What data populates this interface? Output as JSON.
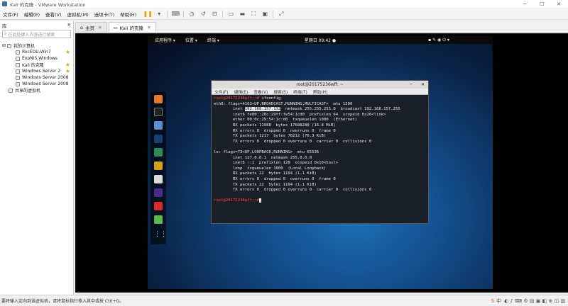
{
  "window": {
    "title": "Kali 的克隆 - VMware Workstation"
  },
  "menu": [
    "文件(F)",
    "编辑(E)",
    "查看(V)",
    "虚拟机(M)",
    "选项卡(T)",
    "帮助(H)"
  ],
  "library": {
    "title": "库",
    "search_placeholder": "在此处键入内容进行搜索",
    "root": "我的计算机",
    "vms": [
      "RocEDU,Win7",
      "ExpNIS.Windows",
      "Kali 的克隆",
      "Windows Server 2",
      "Windows Server 2008",
      "Windows Server 2008"
    ],
    "shared": "共享的虚拟机"
  },
  "tabs": [
    {
      "label": "主页"
    },
    {
      "label": "Kali 的克隆"
    }
  ],
  "guest": {
    "apps": "应用程序 ▾",
    "places": "位置 ▾",
    "terminal": "终端 ▾",
    "clock": "星期日 09:42 ●"
  },
  "terminal": {
    "title": "root@20175236wff: ~",
    "menu": [
      "文件(F)",
      "编辑(E)",
      "查看(V)",
      "搜索(S)",
      "终端(T)",
      "帮助(H)"
    ],
    "prompt": "root@20175236wff:~#",
    "cmd": " ifconfig",
    "lines": [
      "eth0: flags=4163<UP,BROADCAST,RUNNING,MULTICAST>  mtu 1500",
      "        inet ",
      "192.168.157.132",
      "  netmask 255.255.255.0  broadcast 192.168.157.255",
      "        inet6 fe80::20c:29ff:fe54:1cd0  prefixlen 64  scopeid 0x20<link>",
      "        ether 00:0c:29:54:1c:d0  txqueuelen 1000  (Ethernet)",
      "        RX packets 11988  bytes 17688288 (16.8 MiB)",
      "        RX errors 0  dropped 0  overruns 0  frame 0",
      "        TX packets 1217  bytes 78212 (76.3 KiB)",
      "        TX errors 0  dropped 0 overruns 0  carrier 0  collisions 0",
      "",
      "lo: flags=73<UP,LOOPBACK,RUNNING>  mtu 65536",
      "        inet 127.0.0.1  netmask 255.0.0.0",
      "        inet6 ::1  prefixlen 128  scopeid 0x10<host>",
      "        loop  txqueuelen 1000  (Local Loopback)",
      "        RX packets 22  bytes 1194 (1.1 KiB)",
      "        RX errors 0  dropped 0  overruns 0  frame 0",
      "        TX packets 22  bytes 1194 (1.1 KiB)",
      "        TX errors 0  dropped 0 overruns 0  carrier 0  collisions 0",
      ""
    ],
    "prompt2": "root@20175236wff:~#"
  },
  "status": {
    "message": "要将输入定向到该虚拟机，请将鼠标指针移入其中或按 Ctrl+G。"
  },
  "colors": {
    "prompt": "#ff4545",
    "desktop": "#124a86"
  }
}
